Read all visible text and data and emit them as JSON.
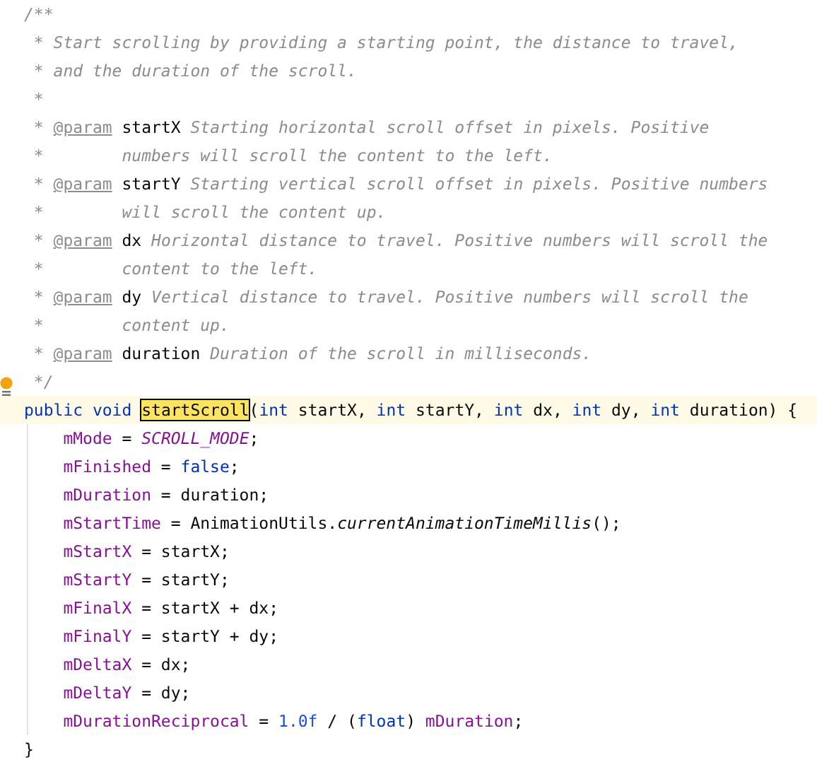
{
  "editor": {
    "lines": [
      {
        "current": false,
        "bulb": false,
        "indented": false,
        "tokens": [
          {
            "text": "/**",
            "kind": "comment"
          }
        ]
      },
      {
        "current": false,
        "bulb": false,
        "indented": false,
        "tokens": [
          {
            "text": " * Start scrolling by providing a starting point, the distance to travel,",
            "kind": "comment"
          }
        ]
      },
      {
        "current": false,
        "bulb": false,
        "indented": false,
        "tokens": [
          {
            "text": " * and the duration of the scroll.",
            "kind": "comment"
          }
        ]
      },
      {
        "current": false,
        "bulb": false,
        "indented": false,
        "tokens": [
          {
            "text": " *",
            "kind": "comment"
          }
        ]
      },
      {
        "current": false,
        "bulb": false,
        "indented": false,
        "tokens": [
          {
            "text": " * ",
            "kind": "comment"
          },
          {
            "text": "@param",
            "kind": "tag"
          },
          {
            "text": " startX",
            "kind": "param"
          },
          {
            "text": " Starting horizontal scroll offset in pixels. Positive",
            "kind": "comment"
          }
        ]
      },
      {
        "current": false,
        "bulb": false,
        "indented": false,
        "tokens": [
          {
            "text": " *        numbers will scroll the content to the left.",
            "kind": "comment"
          }
        ]
      },
      {
        "current": false,
        "bulb": false,
        "indented": false,
        "tokens": [
          {
            "text": " * ",
            "kind": "comment"
          },
          {
            "text": "@param",
            "kind": "tag"
          },
          {
            "text": " startY",
            "kind": "param"
          },
          {
            "text": " Starting vertical scroll offset in pixels. Positive numbers",
            "kind": "comment"
          }
        ]
      },
      {
        "current": false,
        "bulb": false,
        "indented": false,
        "tokens": [
          {
            "text": " *        will scroll the content up.",
            "kind": "comment"
          }
        ]
      },
      {
        "current": false,
        "bulb": false,
        "indented": false,
        "tokens": [
          {
            "text": " * ",
            "kind": "comment"
          },
          {
            "text": "@param",
            "kind": "tag"
          },
          {
            "text": " dx",
            "kind": "param"
          },
          {
            "text": " Horizontal distance to travel. Positive numbers will scroll the",
            "kind": "comment"
          }
        ]
      },
      {
        "current": false,
        "bulb": false,
        "indented": false,
        "tokens": [
          {
            "text": " *        content to the left.",
            "kind": "comment"
          }
        ]
      },
      {
        "current": false,
        "bulb": false,
        "indented": false,
        "tokens": [
          {
            "text": " * ",
            "kind": "comment"
          },
          {
            "text": "@param",
            "kind": "tag"
          },
          {
            "text": " dy",
            "kind": "param"
          },
          {
            "text": " Vertical distance to travel. Positive numbers will scroll the",
            "kind": "comment"
          }
        ]
      },
      {
        "current": false,
        "bulb": false,
        "indented": false,
        "tokens": [
          {
            "text": " *        content up.",
            "kind": "comment"
          }
        ]
      },
      {
        "current": false,
        "bulb": false,
        "indented": false,
        "tokens": [
          {
            "text": " * ",
            "kind": "comment"
          },
          {
            "text": "@param",
            "kind": "tag"
          },
          {
            "text": " duration",
            "kind": "param"
          },
          {
            "text": " Duration of the scroll in milliseconds.",
            "kind": "comment"
          }
        ]
      },
      {
        "current": false,
        "bulb": true,
        "indented": false,
        "tokens": [
          {
            "text": " */",
            "kind": "comment"
          }
        ]
      },
      {
        "current": true,
        "bulb": false,
        "indented": false,
        "tokens": [
          {
            "text": "public void ",
            "kind": "keyword"
          },
          {
            "text": "startScroll",
            "kind": "match"
          },
          {
            "text": "(",
            "kind": "plain"
          },
          {
            "text": "int",
            "kind": "keyword"
          },
          {
            "text": " startX, ",
            "kind": "plain"
          },
          {
            "text": "int",
            "kind": "keyword"
          },
          {
            "text": " startY, ",
            "kind": "plain"
          },
          {
            "text": "int",
            "kind": "keyword"
          },
          {
            "text": " dx, ",
            "kind": "plain"
          },
          {
            "text": "int",
            "kind": "keyword"
          },
          {
            "text": " dy, ",
            "kind": "plain"
          },
          {
            "text": "int",
            "kind": "keyword"
          },
          {
            "text": " duration) {",
            "kind": "plain"
          }
        ]
      },
      {
        "current": false,
        "bulb": false,
        "indented": true,
        "tokens": [
          {
            "text": "mMode",
            "kind": "field"
          },
          {
            "text": " = ",
            "kind": "plain"
          },
          {
            "text": "SCROLL_MODE",
            "kind": "constant"
          },
          {
            "text": ";",
            "kind": "plain"
          }
        ]
      },
      {
        "current": false,
        "bulb": false,
        "indented": true,
        "tokens": [
          {
            "text": "mFinished",
            "kind": "field"
          },
          {
            "text": " = ",
            "kind": "plain"
          },
          {
            "text": "false",
            "kind": "keyword"
          },
          {
            "text": ";",
            "kind": "plain"
          }
        ]
      },
      {
        "current": false,
        "bulb": false,
        "indented": true,
        "tokens": [
          {
            "text": "mDuration",
            "kind": "field"
          },
          {
            "text": " = duration;",
            "kind": "plain"
          }
        ]
      },
      {
        "current": false,
        "bulb": false,
        "indented": true,
        "tokens": [
          {
            "text": "mStartTime",
            "kind": "field"
          },
          {
            "text": " = AnimationUtils.",
            "kind": "plain"
          },
          {
            "text": "currentAnimationTimeMillis",
            "kind": "static"
          },
          {
            "text": "();",
            "kind": "plain"
          }
        ]
      },
      {
        "current": false,
        "bulb": false,
        "indented": true,
        "tokens": [
          {
            "text": "mStartX",
            "kind": "field"
          },
          {
            "text": " = startX;",
            "kind": "plain"
          }
        ]
      },
      {
        "current": false,
        "bulb": false,
        "indented": true,
        "tokens": [
          {
            "text": "mStartY",
            "kind": "field"
          },
          {
            "text": " = startY;",
            "kind": "plain"
          }
        ]
      },
      {
        "current": false,
        "bulb": false,
        "indented": true,
        "tokens": [
          {
            "text": "mFinalX",
            "kind": "field"
          },
          {
            "text": " = startX + dx;",
            "kind": "plain"
          }
        ]
      },
      {
        "current": false,
        "bulb": false,
        "indented": true,
        "tokens": [
          {
            "text": "mFinalY",
            "kind": "field"
          },
          {
            "text": " = startY + dy;",
            "kind": "plain"
          }
        ]
      },
      {
        "current": false,
        "bulb": false,
        "indented": true,
        "tokens": [
          {
            "text": "mDeltaX",
            "kind": "field"
          },
          {
            "text": " = dx;",
            "kind": "plain"
          }
        ]
      },
      {
        "current": false,
        "bulb": false,
        "indented": true,
        "tokens": [
          {
            "text": "mDeltaY",
            "kind": "field"
          },
          {
            "text": " = dy;",
            "kind": "plain"
          }
        ]
      },
      {
        "current": false,
        "bulb": false,
        "indented": true,
        "tokens": [
          {
            "text": "mDurationReciprocal",
            "kind": "field"
          },
          {
            "text": " = ",
            "kind": "plain"
          },
          {
            "text": "1.0f",
            "kind": "number"
          },
          {
            "text": " / (",
            "kind": "plain"
          },
          {
            "text": "float",
            "kind": "keyword"
          },
          {
            "text": ") ",
            "kind": "plain"
          },
          {
            "text": "mDuration",
            "kind": "field"
          },
          {
            "text": ";",
            "kind": "plain"
          }
        ]
      },
      {
        "current": false,
        "bulb": false,
        "indented": false,
        "tokens": [
          {
            "text": "}",
            "kind": "plain"
          }
        ]
      }
    ]
  }
}
